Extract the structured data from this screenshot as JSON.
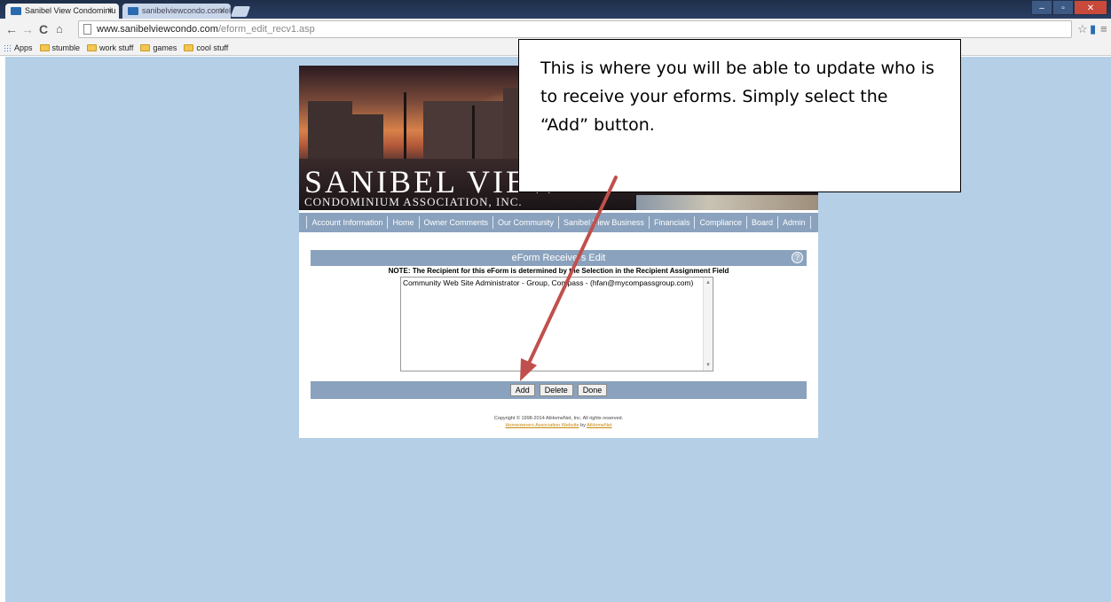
{
  "browser": {
    "tabs": [
      {
        "title": "Sanibel View Condominiu",
        "active": true
      },
      {
        "title": "sanibelviewcondo.com/el",
        "active": false
      }
    ],
    "url_host": "www.sanibelviewcondo.com",
    "url_path": "/eform_edit_recv1.asp",
    "bookmarks": [
      {
        "label": "Apps",
        "icon": "apps-grid-icon"
      },
      {
        "label": "stumble",
        "icon": "folder-icon"
      },
      {
        "label": "work stuff",
        "icon": "folder-icon"
      },
      {
        "label": "games",
        "icon": "folder-icon"
      },
      {
        "label": "cool stuff",
        "icon": "folder-icon"
      }
    ]
  },
  "site": {
    "brand_title": "SANIBEL VIEW",
    "brand_subtitle": "CONDOMINIUM ASSOCIATION, INC.",
    "nav": [
      "Account Information",
      "Home",
      "Owner Comments",
      "Our Community",
      "Sanibel View Business",
      "Financials",
      "Compliance",
      "Board",
      "Admin"
    ]
  },
  "form": {
    "title": "eForm Receivers Edit",
    "help_glyph": "?",
    "note": "NOTE: The Recipient for this eForm is determined by the Selection in the Recipient Assignment Field",
    "recipients": [
      "Community Web Site Administrator - Group, Compass - (hfan@mycompassgroup.com)"
    ],
    "buttons": {
      "add": "Add",
      "delete": "Delete",
      "done": "Done"
    }
  },
  "footer": {
    "copyright": "Copyright © 1998-2014 AtHomeNet, Inc. All rights reserved.",
    "link1": "Homeowners Association Website",
    "by": "by",
    "link2": "AtHomeNet"
  },
  "callout": {
    "text": "This is where you will be able to update who is to receive your eforms. Simply select the “Add” button."
  },
  "colors": {
    "page_background": "#b5cfe7",
    "nav_blue": "#8aa2bd",
    "arrow": "#c0504d"
  }
}
